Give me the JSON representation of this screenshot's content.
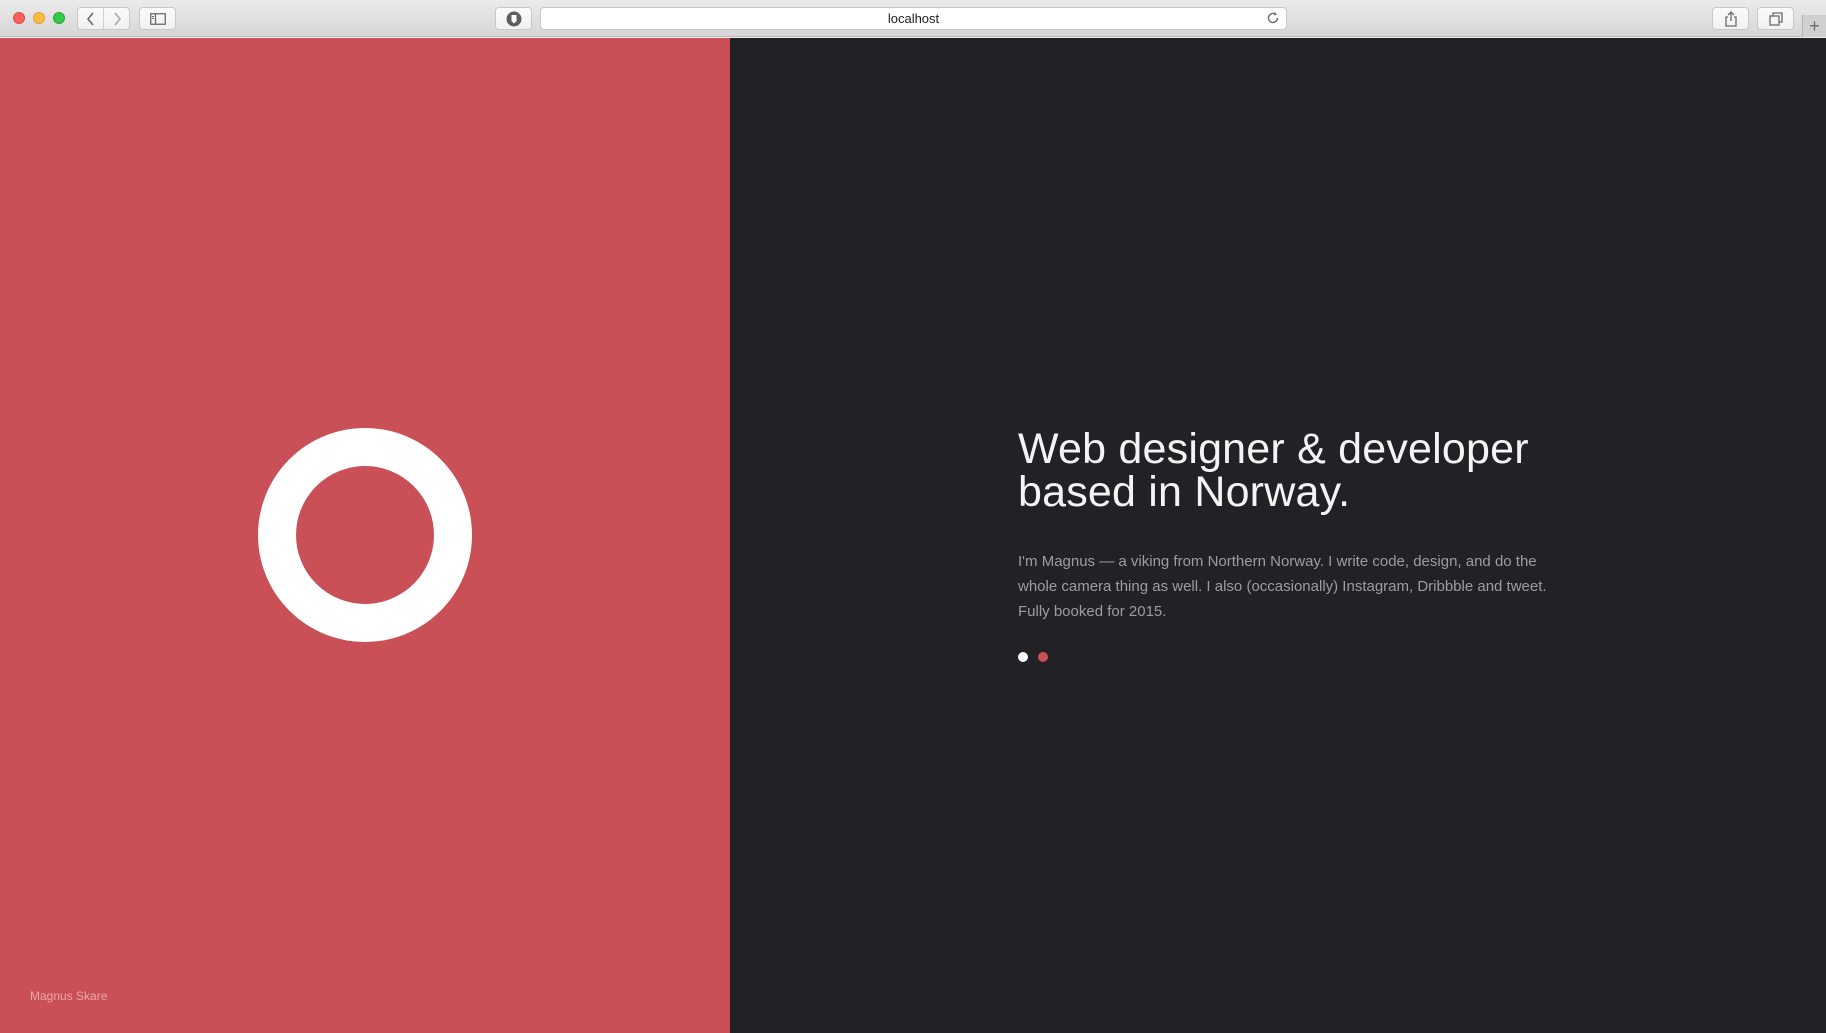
{
  "browser": {
    "url": "localhost",
    "icons": {
      "back": "chevron-left-icon",
      "forward": "chevron-right-icon",
      "sidebar": "sidebar-icon",
      "extension": "shield-icon",
      "reload": "reload-icon",
      "share": "share-icon",
      "tabs": "tabs-icon",
      "new_tab": "plus-icon"
    }
  },
  "page": {
    "author": "Magnus Skare",
    "headline": {
      "line1": "Web designer & developer",
      "line2": "based in Norway."
    },
    "bio": "I'm Magnus — a viking from Northern Norway. I write code, design, and do the whole camera thing as well. I also (occasionally) Instagram, Dribbble and tweet. Fully booked for 2015.",
    "logo_icon": "ring-icon",
    "pager": {
      "active_index": 0,
      "count": 2
    }
  },
  "colors": {
    "left_panel_bg": "#c95057",
    "right_panel_bg": "#222226",
    "accent": "#c95057",
    "dot_active": "#ffffff",
    "dot_inactive": "#c95057"
  }
}
